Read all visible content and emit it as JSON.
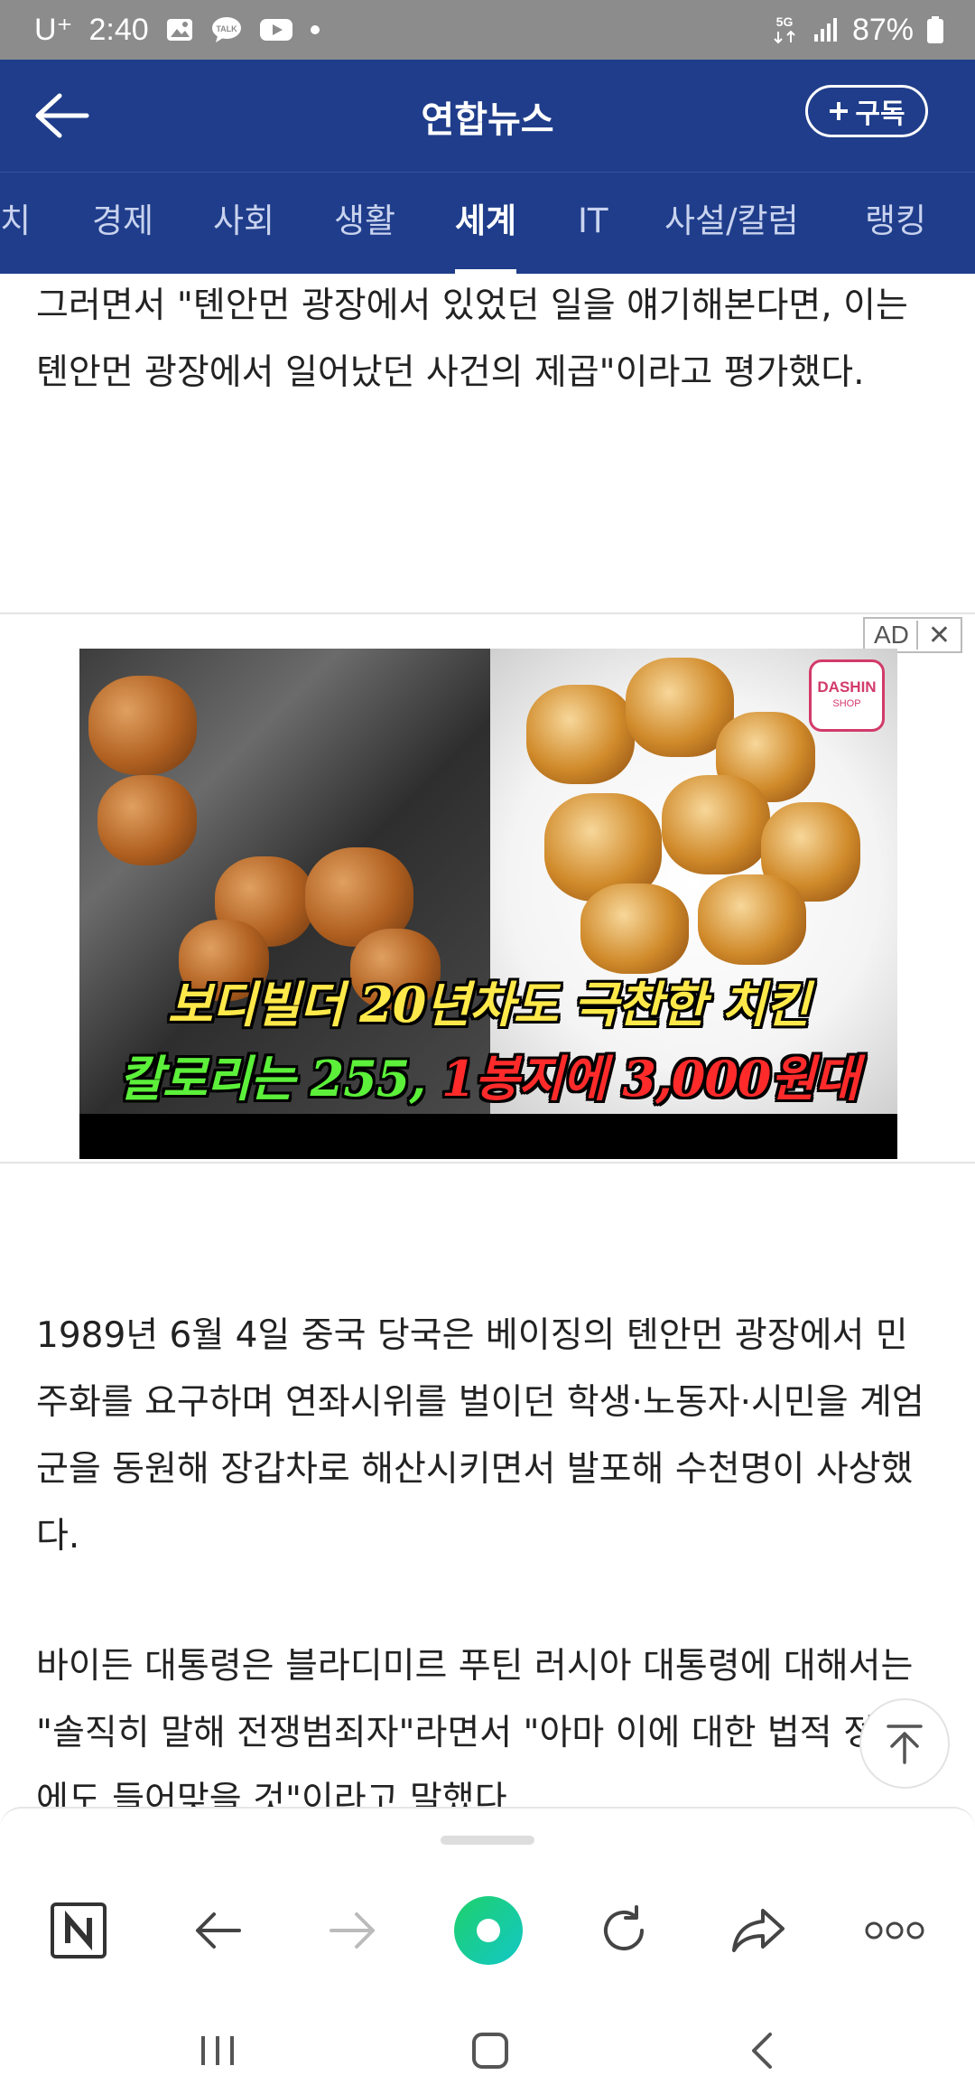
{
  "status_bar": {
    "carrier": "U⁺",
    "time": "2:40",
    "network": "5G",
    "battery": "87%"
  },
  "header": {
    "title": "연합뉴스",
    "subscribe_label": "구독"
  },
  "tabs": [
    {
      "label": "치",
      "active": false
    },
    {
      "label": "경제",
      "active": false
    },
    {
      "label": "사회",
      "active": false
    },
    {
      "label": "생활",
      "active": false
    },
    {
      "label": "세계",
      "active": true
    },
    {
      "label": "IT",
      "active": false
    },
    {
      "label": "사설/칼럼",
      "active": false
    },
    {
      "label": "랭킹",
      "active": false
    }
  ],
  "article": {
    "para1": "그러면서 \"톈안먼 광장에서 있었던 일을 얘기해본다면, 이는 톈안먼 광장에서 일어났던 사건의 제곱\"이라고 평가했다.",
    "para2": "1989년 6월 4일 중국 당국은 베이징의 톈안먼 광장에서 민주화를 요구하며 연좌시위를 벌이던 학생·노동자·시민을 계엄군을 동원해 장갑차로 해산시키면서 발포해 수천명이 사상했다.",
    "para3": "바이든 대통령은 블라디미르 푸틴 러시아 대통령에 대해서는 \"솔직히 말해 전쟁범죄자\"라면서 \"아마 이에 대한 법적 정의에도 들어맞을 것\"이라고 말했다."
  },
  "ad": {
    "badge_label": "AD",
    "close_symbol": "✕",
    "logo_text": "DASHIN",
    "logo_sub": "SHOP",
    "headline": "보디빌더 20년차도 극찬한 치킨",
    "caption_green": "칼로리는 255,",
    "caption_red": "1봉지에 3,000원대"
  }
}
